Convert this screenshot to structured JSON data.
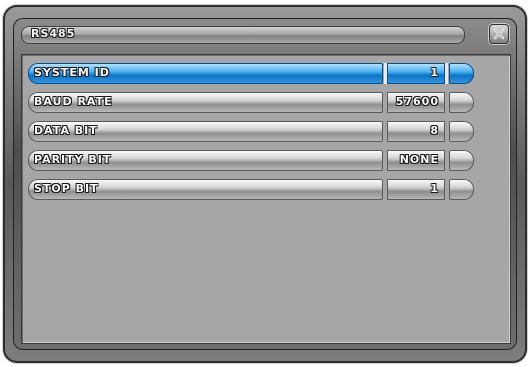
{
  "window": {
    "title": "RS485",
    "close_icon": "close-icon"
  },
  "rows": [
    {
      "label": "SYSTEM ID",
      "value": "1",
      "selected": true
    },
    {
      "label": "BAUD RATE",
      "value": "57600",
      "selected": false
    },
    {
      "label": "DATA BIT",
      "value": "8",
      "selected": false
    },
    {
      "label": "PARITY BIT",
      "value": "NONE",
      "selected": false
    },
    {
      "label": "STOP BIT",
      "value": "1",
      "selected": false
    }
  ],
  "colors": {
    "selected_accent": "#0c73c8",
    "panel_background": "#a6a6a6",
    "frame": "#5a5a5a"
  }
}
